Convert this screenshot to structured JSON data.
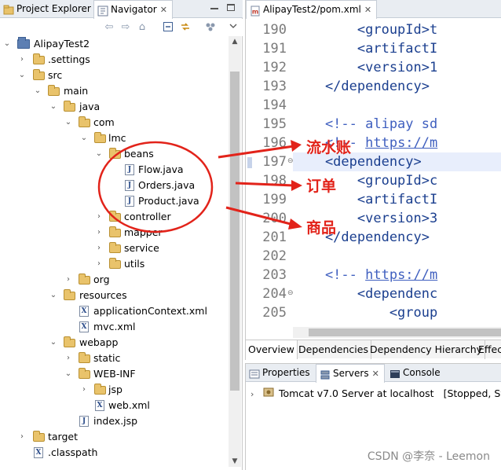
{
  "left_tabs": [
    {
      "label": "Project Explorer"
    },
    {
      "label": "Navigator",
      "close": "✕"
    }
  ],
  "tree": [
    {
      "label": "AlipayTest2",
      "icon": "project-icon"
    },
    {
      "label": ".settings",
      "icon": "folder-icon"
    },
    {
      "label": "src",
      "icon": "folder-icon"
    },
    {
      "label": "main",
      "icon": "folder-icon"
    },
    {
      "label": "java",
      "icon": "folder-icon"
    },
    {
      "label": "com",
      "icon": "folder-icon"
    },
    {
      "label": "lmc",
      "icon": "folder-icon"
    },
    {
      "label": "beans",
      "icon": "folder-icon"
    },
    {
      "label": "Flow.java",
      "icon": "java-file-icon"
    },
    {
      "label": "Orders.java",
      "icon": "java-file-icon"
    },
    {
      "label": "Product.java",
      "icon": "java-file-icon"
    },
    {
      "label": "controller",
      "icon": "folder-icon"
    },
    {
      "label": "mapper",
      "icon": "folder-icon"
    },
    {
      "label": "service",
      "icon": "folder-icon"
    },
    {
      "label": "utils",
      "icon": "folder-icon"
    },
    {
      "label": "org",
      "icon": "folder-icon"
    },
    {
      "label": "resources",
      "icon": "folder-icon"
    },
    {
      "label": "applicationContext.xml",
      "icon": "xml-file-icon"
    },
    {
      "label": "mvc.xml",
      "icon": "xml-file-icon"
    },
    {
      "label": "webapp",
      "icon": "folder-icon"
    },
    {
      "label": "static",
      "icon": "folder-icon"
    },
    {
      "label": "WEB-INF",
      "icon": "folder-icon"
    },
    {
      "label": "jsp",
      "icon": "folder-icon"
    },
    {
      "label": "web.xml",
      "icon": "xml-file-icon"
    },
    {
      "label": "index.jsp",
      "icon": "jsp-file-icon"
    },
    {
      "label": "target",
      "icon": "folder-icon"
    },
    {
      "label": ".classpath",
      "icon": "file-icon"
    }
  ],
  "annotations": {
    "flow": "流水账",
    "orders": "订单",
    "product": "商品",
    "color": "#e2231a"
  },
  "editor": {
    "tab_label": "AlipayTest2/pom.xml",
    "tab_close": "✕",
    "line_numbers": [
      "190",
      "191",
      "192",
      "193",
      "194",
      "195",
      "196",
      "197",
      "198",
      "199",
      "200",
      "201",
      "202",
      "203",
      "204",
      "205"
    ],
    "lines": [
      "        <groupId>t",
      "        <artifactI",
      "        <version>1",
      "    </dependency>",
      "",
      "    <!-- alipay sd",
      "    <!-- https://m",
      "    <dependency>",
      "        <groupId>c",
      "        <artifactI",
      "        <version>3",
      "    </dependency>",
      "",
      "    <!-- https://m",
      "        <dependenc",
      "            <group"
    ],
    "bottom_tabs": [
      "Overview",
      "Dependencies",
      "Dependency Hierarchy",
      "Effec"
    ]
  },
  "bottom_panel": {
    "tabs": [
      {
        "label": "Properties"
      },
      {
        "label": "Servers",
        "close": "✕"
      },
      {
        "label": "Console"
      }
    ],
    "server_row": "Tomcat v7.0 Server at localhost",
    "server_status": "[Stopped, Sync"
  },
  "watermark": "CSDN @李奈 - Leemon"
}
